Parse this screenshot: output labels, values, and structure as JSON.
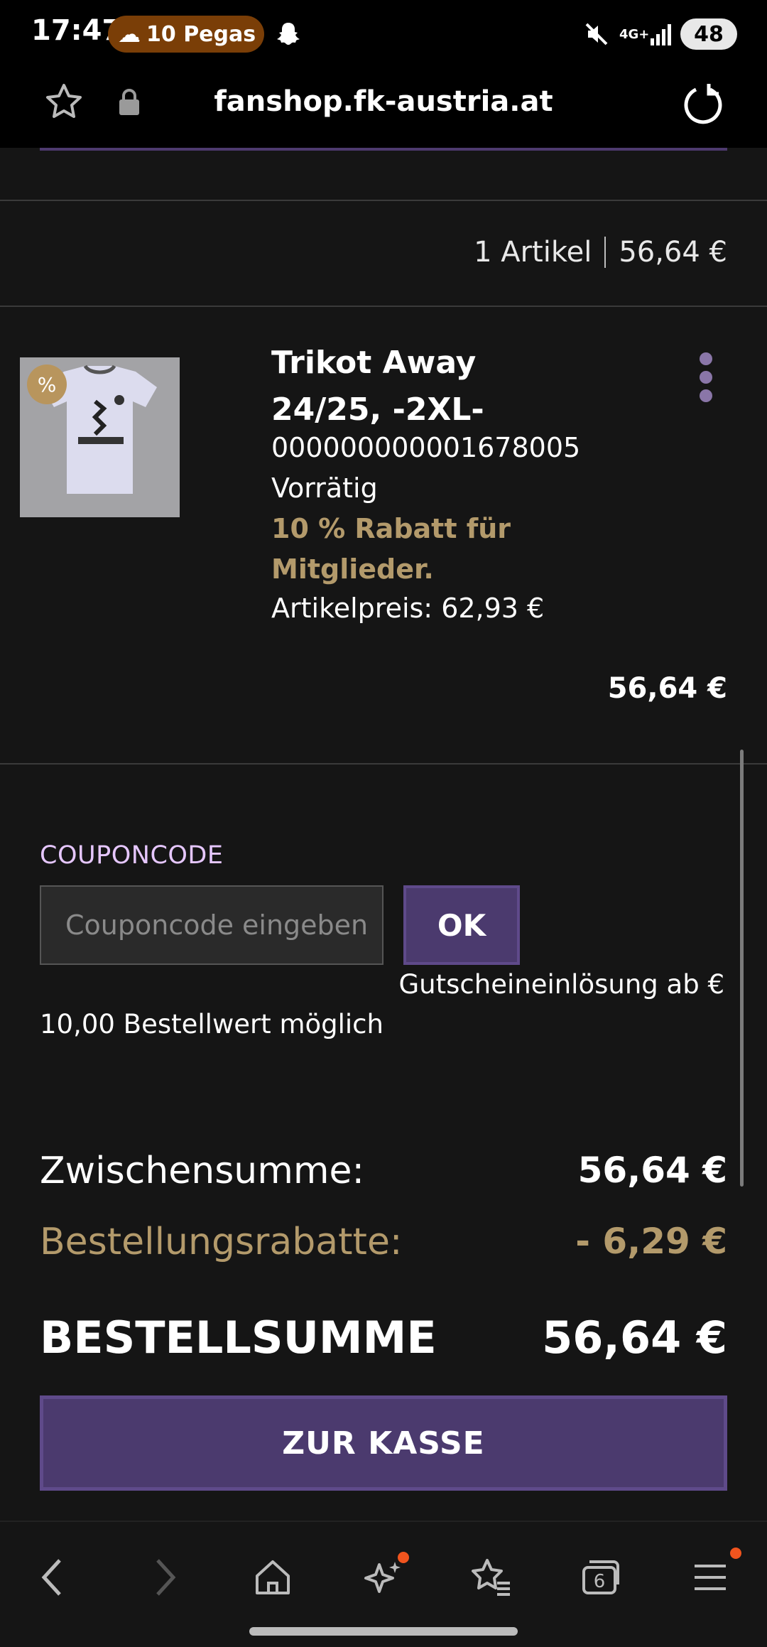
{
  "status_bar": {
    "time": "17:47",
    "notification_text": "10 Pegas",
    "network": "4G+",
    "battery": "48"
  },
  "browser": {
    "url": "fanshop.fk-austria.at"
  },
  "cart_summary": {
    "item_count": "1 Artikel",
    "total": "56,64 €"
  },
  "product": {
    "title": "Trikot Away 24/25, -2XL-",
    "sku": "000000000001678005",
    "availability": "Vorrätig",
    "discount_text": "10 % Rabatt für Mitglieder.",
    "unit_price": "Artikelpreis: 62,93 €",
    "line_total": "56,64 €",
    "badge": "%"
  },
  "coupon": {
    "label": "COUPONCODE",
    "placeholder": "Couponcode eingeben",
    "button": "OK",
    "note_line1": "Gutscheineinlösung ab €",
    "note_line2": "10,00 Bestellwert möglich"
  },
  "totals": {
    "subtotal_label": "Zwischensumme:",
    "subtotal_value": "56,64 €",
    "discount_label": "Bestellungsrabatte:",
    "discount_value": "- 6,29 €",
    "total_label": "BESTELLSUMME",
    "total_value": "56,64 €"
  },
  "checkout": {
    "button": "ZUR KASSE"
  },
  "bottom_nav": {
    "tabs_count": "6"
  },
  "colors": {
    "accent_purple": "#4b3a6e",
    "discount_gold": "#b39a6b",
    "label_lavender": "#e6c7ff",
    "background": "#151515"
  }
}
